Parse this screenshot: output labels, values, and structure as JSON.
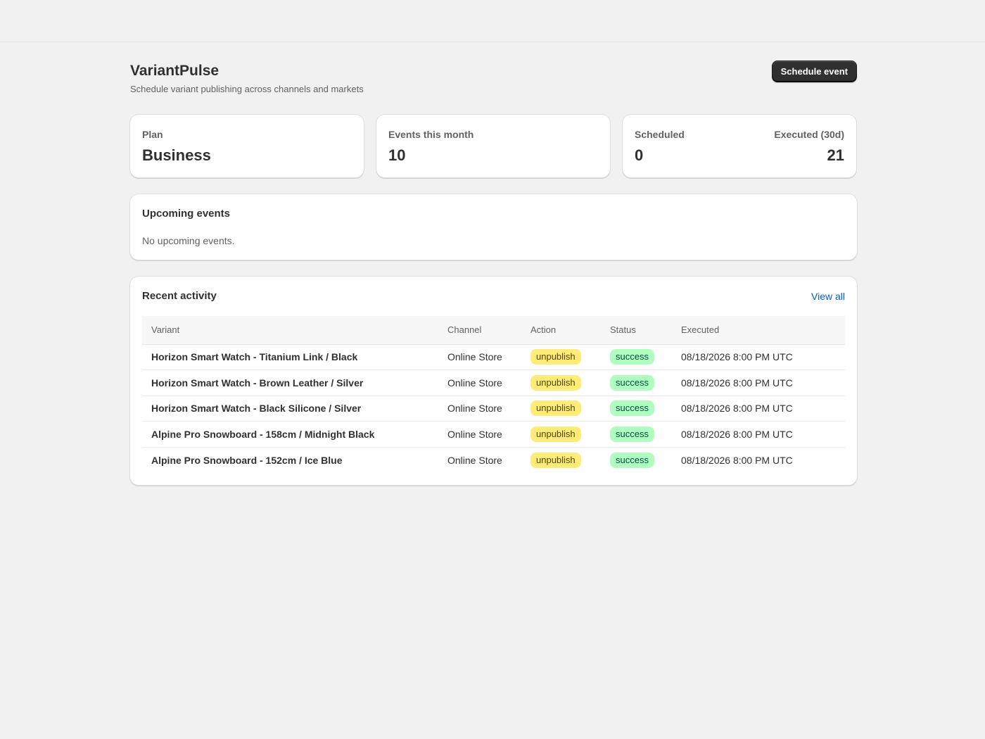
{
  "app": {
    "title": "VariantPulse",
    "subtitle": "Schedule variant publishing across channels and markets",
    "primary_action": "Schedule event"
  },
  "stats": {
    "plan": {
      "label": "Plan",
      "value": "Business"
    },
    "events": {
      "label": "Events this month",
      "value": "10"
    },
    "scheduled": {
      "label": "Scheduled",
      "value": "0"
    },
    "executed": {
      "label": "Executed (30d)",
      "value": "21"
    }
  },
  "upcoming": {
    "title": "Upcoming events",
    "empty_text": "No upcoming events."
  },
  "recent": {
    "title": "Recent activity",
    "view_all": "View all",
    "columns": [
      "Variant",
      "Channel",
      "Action",
      "Status",
      "Executed"
    ],
    "rows": [
      {
        "variant": "Horizon Smart Watch - Titanium Link / Black",
        "channel": "Online Store",
        "action": "unpublish",
        "status": "success",
        "executed": "08/18/2026 8:00 PM UTC"
      },
      {
        "variant": "Horizon Smart Watch - Brown Leather / Silver",
        "channel": "Online Store",
        "action": "unpublish",
        "status": "success",
        "executed": "08/18/2026 8:00 PM UTC"
      },
      {
        "variant": "Horizon Smart Watch - Black Silicone / Silver",
        "channel": "Online Store",
        "action": "unpublish",
        "status": "success",
        "executed": "08/18/2026 8:00 PM UTC"
      },
      {
        "variant": "Alpine Pro Snowboard - 158cm / Midnight Black",
        "channel": "Online Store",
        "action": "unpublish",
        "status": "success",
        "executed": "08/18/2026 8:00 PM UTC"
      },
      {
        "variant": "Alpine Pro Snowboard - 152cm / Ice Blue",
        "channel": "Online Store",
        "action": "unpublish",
        "status": "success",
        "executed": "08/18/2026 8:00 PM UTC"
      }
    ]
  },
  "colors": {
    "background": "#f1f1f1",
    "primary_button": "#303030",
    "link": "#005bd3",
    "action_badge": "#ffeb78",
    "status_badge": "#affebf"
  }
}
